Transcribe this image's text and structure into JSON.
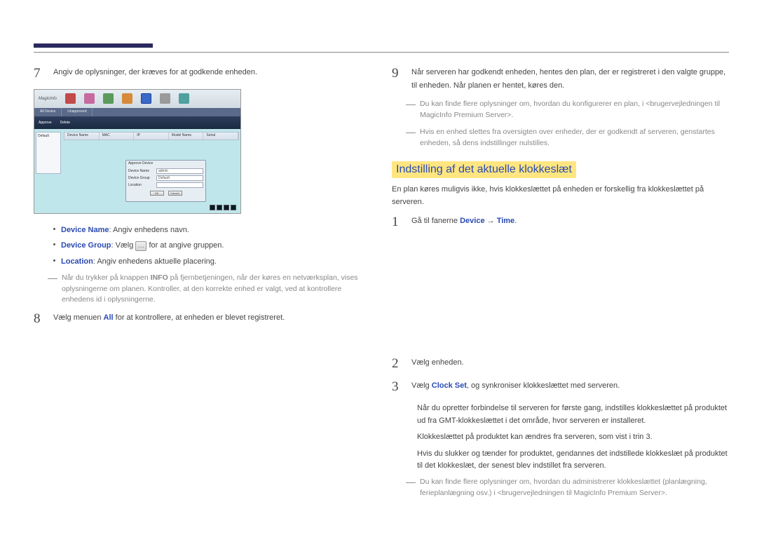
{
  "left": {
    "step7": {
      "num": "7",
      "text": "Angiv de oplysninger, der kræves for at godkende enheden."
    },
    "screenshot": {
      "logo": "MagicInfo",
      "strip_tabs": [
        "All Device",
        "Unapproved"
      ],
      "strip_sub": [
        "Approve",
        "Delete"
      ],
      "side": "Default",
      "table_headers": [
        "Device Name",
        "MAC",
        "IP",
        "Model Name",
        "Serial"
      ],
      "modal": {
        "title": "Approve Device",
        "rows": [
          {
            "label": "Device Name",
            "value": "admin"
          },
          {
            "label": "Device Group",
            "value": "Default"
          },
          {
            "label": "Location",
            "value": ""
          }
        ],
        "ok": "OK",
        "cancel": "Cancel"
      }
    },
    "bullets": {
      "b1_label": "Device Name",
      "b1_text": ": Angiv enhedens navn.",
      "b2_label": "Device Group",
      "b2_pre": ": Vælg ",
      "b2_btn": "…",
      "b2_post": " for at angive gruppen.",
      "b3_label": "Location",
      "b3_text": ": Angiv enhedens aktuelle placering."
    },
    "note7_pre": "Når du trykker på knappen ",
    "note7_info": "INFO",
    "note7_post": " på fjernbetjeningen, når der køres en netværksplan, vises oplysningerne om planen. Kontroller, at den korrekte enhed er valgt, ved at kontrollere enhedens id i oplysningerne.",
    "step8": {
      "num": "8",
      "pre": "Vælg menuen ",
      "all": "All",
      "post": " for at kontrollere, at enheden er blevet registreret."
    }
  },
  "right": {
    "step9": {
      "num": "9",
      "text": "Når serveren har godkendt enheden, hentes den plan, der er registreret i den valgte gruppe, til enheden. Når planen er hentet, køres den."
    },
    "note9a": "Du kan finde flere oplysninger om, hvordan du konfigurerer en plan, i <brugervejledningen til MagicInfo Premium Server>.",
    "note9b": "Hvis en enhed slettes fra oversigten over enheder, der er godkendt af serveren, genstartes enheden, så dens indstillinger nulstilles.",
    "section_title": "Indstilling af det aktuelle klokkeslæt",
    "section_intro": "En plan køres muligvis ikke, hvis klokkeslættet på enheden er forskellig fra klokkeslættet på serveren.",
    "step1": {
      "num": "1",
      "pre": "Gå til fanerne ",
      "device": "Device",
      "arrow": " → ",
      "time": "Time",
      "dot": "."
    },
    "step2": {
      "num": "2",
      "text": "Vælg enheden."
    },
    "step3": {
      "num": "3",
      "pre": "Vælg ",
      "clock": "Clock Set",
      "post": ", og synkroniser klokkeslættet med serveren."
    },
    "bullets": {
      "b1": "Når du opretter forbindelse til serveren for første gang, indstilles klokkeslættet på produktet ud fra GMT-klokkeslættet i det område, hvor serveren er installeret.",
      "b2": "Klokkeslættet på produktet kan ændres fra serveren, som vist i trin 3.",
      "b3": "Hvis du slukker og tænder for produktet, gendannes det indstillede klokkeslæt på produktet til det klokkeslæt, der senest blev indstillet fra serveren."
    },
    "note3": "Du kan finde flere oplysninger om, hvordan du administrerer klokkeslættet (planlægning, ferieplanlægning osv.) i <brugervejledningen til MagicInfo Premium Server>."
  }
}
